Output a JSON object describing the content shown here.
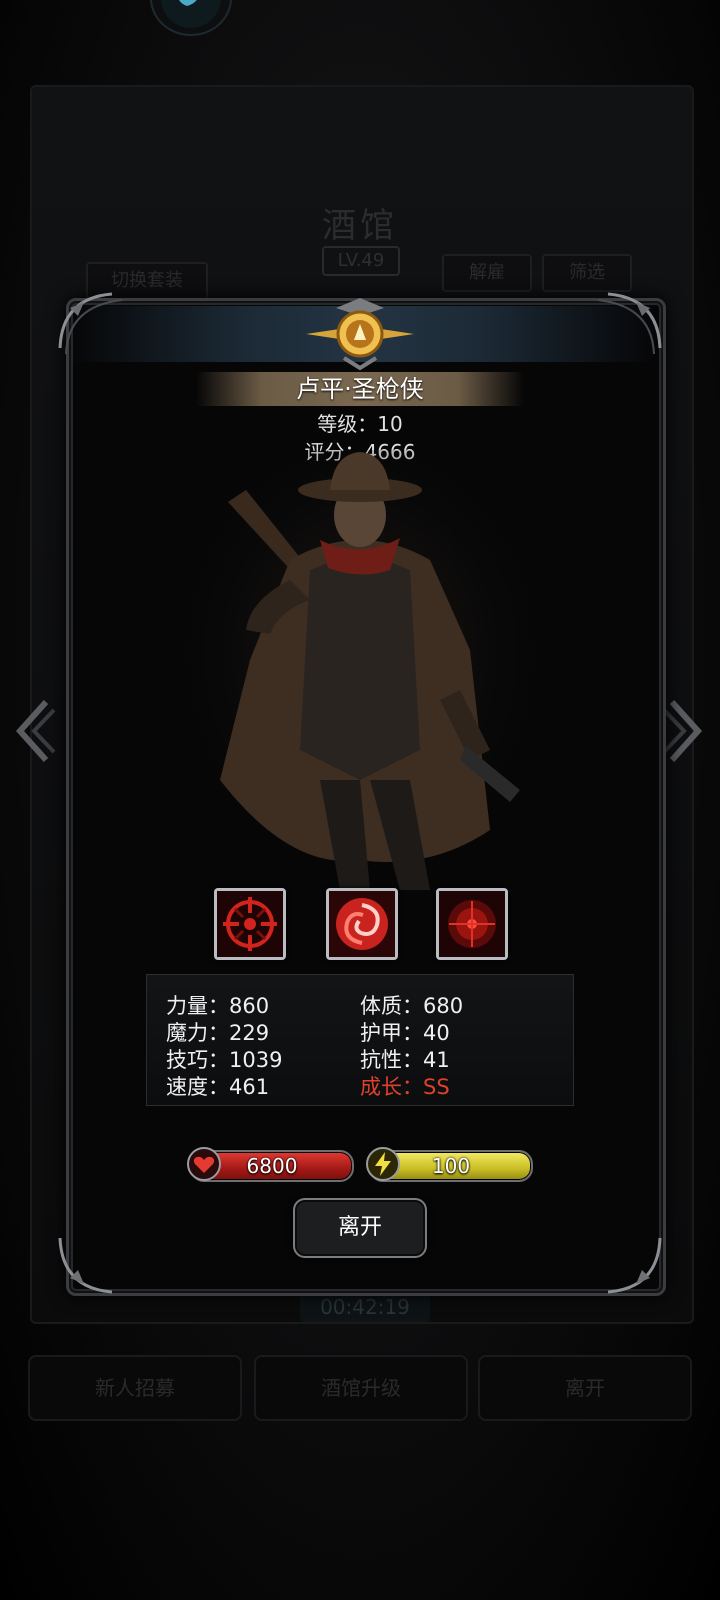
{
  "background": {
    "title": "酒馆",
    "level": "LV.49",
    "switch_outfit": "切换套装",
    "dismiss": "解雇",
    "filter": "筛选",
    "timer": "00:42:19",
    "tabs": [
      "新人招募",
      "酒馆升级",
      "离开"
    ]
  },
  "hero": {
    "name": "卢平·圣枪侠",
    "level_text": "等级：10",
    "score_text": "评分：4666"
  },
  "skills": [
    {
      "icon": "crosshair-skill-icon"
    },
    {
      "icon": "swirl-skill-icon"
    },
    {
      "icon": "target-scope-skill-icon"
    }
  ],
  "stats": {
    "left": [
      "力量：860",
      "魔力：229",
      "技巧：1039",
      "速度：461"
    ],
    "right": [
      "体质：680",
      "护甲：40",
      "抗性：41",
      "成长：SS"
    ]
  },
  "bars": {
    "hp": "6800",
    "energy": "100"
  },
  "buttons": {
    "leave": "离开"
  },
  "colors": {
    "growth_highlight": "#e0412c",
    "hp_bar": "#c8231f",
    "energy_bar": "#d9cf2d"
  }
}
